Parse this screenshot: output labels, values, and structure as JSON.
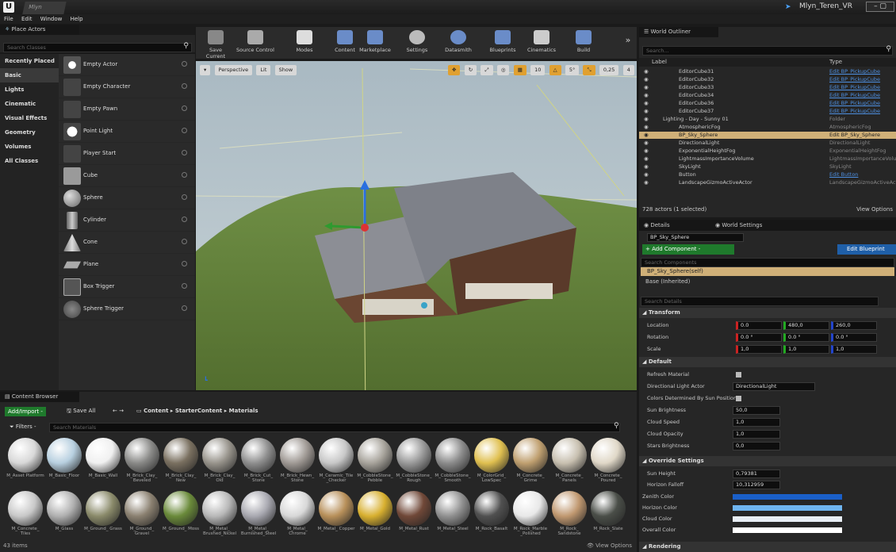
{
  "window": {
    "app_tab": "Mlyn",
    "project_title": "Mlyn_Teren_VR"
  },
  "menu": [
    "File",
    "Edit",
    "Window",
    "Help"
  ],
  "place_actors": {
    "title": "Place Actors",
    "search_placeholder": "Search Classes",
    "categories": [
      "Recently Placed",
      "Basic",
      "Lights",
      "Cinematic",
      "Visual Effects",
      "Geometry",
      "Volumes",
      "All Classes"
    ],
    "items": [
      "Empty Actor",
      "Empty Character",
      "Empty Pawn",
      "Point Light",
      "Player Start",
      "Cube",
      "Sphere",
      "Cylinder",
      "Cone",
      "Plane",
      "Box Trigger",
      "Sphere Trigger"
    ]
  },
  "toolbar": [
    "Save Current",
    "Source Control",
    "Modes",
    "Content",
    "Marketplace",
    "Settings",
    "Datasmith",
    "Blueprints",
    "Cinematics",
    "Build"
  ],
  "viewport": {
    "perspective": "Perspective",
    "lit": "Lit",
    "show": "Show",
    "snap_grid": "10",
    "snap_rot": "5°",
    "snap_scale": "0,25",
    "cam_speed": "4"
  },
  "outliner": {
    "title": "World Outliner",
    "search_placeholder": "Search...",
    "col_label": "Label",
    "col_type": "Type",
    "rows": [
      {
        "label": "EditorCube31",
        "type": "Edit BP_PickupCube",
        "link": true
      },
      {
        "label": "EditorCube32",
        "type": "Edit BP_PickupCube",
        "link": true
      },
      {
        "label": "EditorCube33",
        "type": "Edit BP_PickupCube",
        "link": true
      },
      {
        "label": "EditorCube34",
        "type": "Edit BP_PickupCube",
        "link": true
      },
      {
        "label": "EditorCube36",
        "type": "Edit BP_PickupCube",
        "link": true
      },
      {
        "label": "EditorCube37",
        "type": "Edit BP_PickupCube",
        "link": true
      },
      {
        "label": "Lighting - Day - Sunny 01",
        "type": "Folder",
        "link": false
      },
      {
        "label": "AtmosphericFog",
        "type": "AtmosphericFog",
        "link": false
      },
      {
        "label": "BP_Sky_Sphere",
        "type": "Edit BP_Sky_Sphere",
        "link": true,
        "selected": true
      },
      {
        "label": "DirectionalLight",
        "type": "DirectionalLight",
        "link": false
      },
      {
        "label": "ExponentialHeightFog",
        "type": "ExponentialHeightFog",
        "link": false
      },
      {
        "label": "LightmassImportanceVolume",
        "type": "LightmassImportanceVolu",
        "link": false
      },
      {
        "label": "SkyLight",
        "type": "SkyLight",
        "link": false
      },
      {
        "label": "Button",
        "type": "Edit Button",
        "link": true
      },
      {
        "label": "LandscapeGizmoActiveActor",
        "type": "LandscapeGizmoActiveAct",
        "link": false
      }
    ],
    "footer": "728 actors (1 selected)",
    "view_options": "View Options"
  },
  "details": {
    "tab_details": "Details",
    "tab_world": "World Settings",
    "actor_name": "BP_Sky_Sphere",
    "add_component": "+ Add Component -",
    "edit_blueprint": "Edit Blueprint",
    "search_components": "Search Components",
    "self": "BP_Sky_Sphere(self)",
    "base": "Base (Inherited)",
    "search_details": "Search Details",
    "transform": "Transform",
    "location": {
      "label": "Location",
      "x": "0.0",
      "y": "480,0",
      "z": "260,0"
    },
    "rotation": {
      "label": "Rotation",
      "x": "0.0 °",
      "y": "0.0 °",
      "z": "0.0 °"
    },
    "scale": {
      "label": "Scale",
      "x": "1,0",
      "y": "1,0",
      "z": "1,0"
    },
    "default": "Default",
    "refresh": "Refresh Material",
    "dir_light_label": "Directional Light Actor",
    "dir_light_value": "DirectionalLight",
    "colors_sun": "Colors Determined By Sun Position",
    "sun_brightness": {
      "label": "Sun Brightness",
      "value": "50,0"
    },
    "cloud_speed": {
      "label": "Cloud Speed",
      "value": "1,0"
    },
    "cloud_opacity": {
      "label": "Cloud Opacity",
      "value": "1,0"
    },
    "stars": {
      "label": "Stars Brightness",
      "value": "0,0"
    },
    "override": "Override Settings",
    "sun_height": {
      "label": "Sun Height",
      "value": "0,79381"
    },
    "horizon_falloff": {
      "label": "Horizon Falloff",
      "value": "10,312959"
    },
    "zenith": "Zenith Color",
    "horizon": "Horizon Color",
    "cloud_color": "Cloud Color",
    "overall": "Overall Color",
    "rendering": "Rendering",
    "colors": {
      "zenith": "#1a5fc8",
      "horizon": "#6fb5f0",
      "cloud": "#e8eef5",
      "overall": "#ffffff"
    }
  },
  "content_browser": {
    "title": "Content Browser",
    "add_import": "Add/Import -",
    "save_all": "Save All",
    "path": [
      "Content",
      "StarterContent",
      "Materials"
    ],
    "filters": "Filters -",
    "search_placeholder": "Search Materials",
    "row1": [
      "M_Asset Platform",
      "M_Basic_Floor",
      "M_Basic_Wall",
      "M_Brick_Clay_ Beveled",
      "M_Brick_Clay_ New",
      "M_Brick_Clay_ Old",
      "M_Brick_Cut_ Stone",
      "M_Brick_Hewn_ Stone",
      "M_Ceramic_Tile _Checker",
      "M_CobbleStone_ Pebble",
      "M_CobbleStone_ Rough",
      "M_CobbleStone_ Smooth",
      "M_ColorGrid_ LowSpec",
      "M_Concrete_ Grime",
      "M_Concrete_ Panels",
      "M_Concrete_ Poured"
    ],
    "row2": [
      "M_Concrete_ Tiles",
      "M_Glass",
      "M_Ground_ Grass",
      "M_Ground_ Gravel",
      "M_Ground_ Moss",
      "M_Metal_ Brushed_Nickel",
      "M_Metal_ Burnished_Steel",
      "M_Metal_ Chrome",
      "M_Metal_ Copper",
      "M_Metal_Gold",
      "M_Metal_Rust",
      "M_Metal_Steel",
      "M_Rock_Basalt",
      "M_Rock_Marble _Polished",
      "M_Rock_ Sandstone",
      "M_Rock_Slate"
    ],
    "count": "43 items",
    "view_options": "View Options"
  }
}
